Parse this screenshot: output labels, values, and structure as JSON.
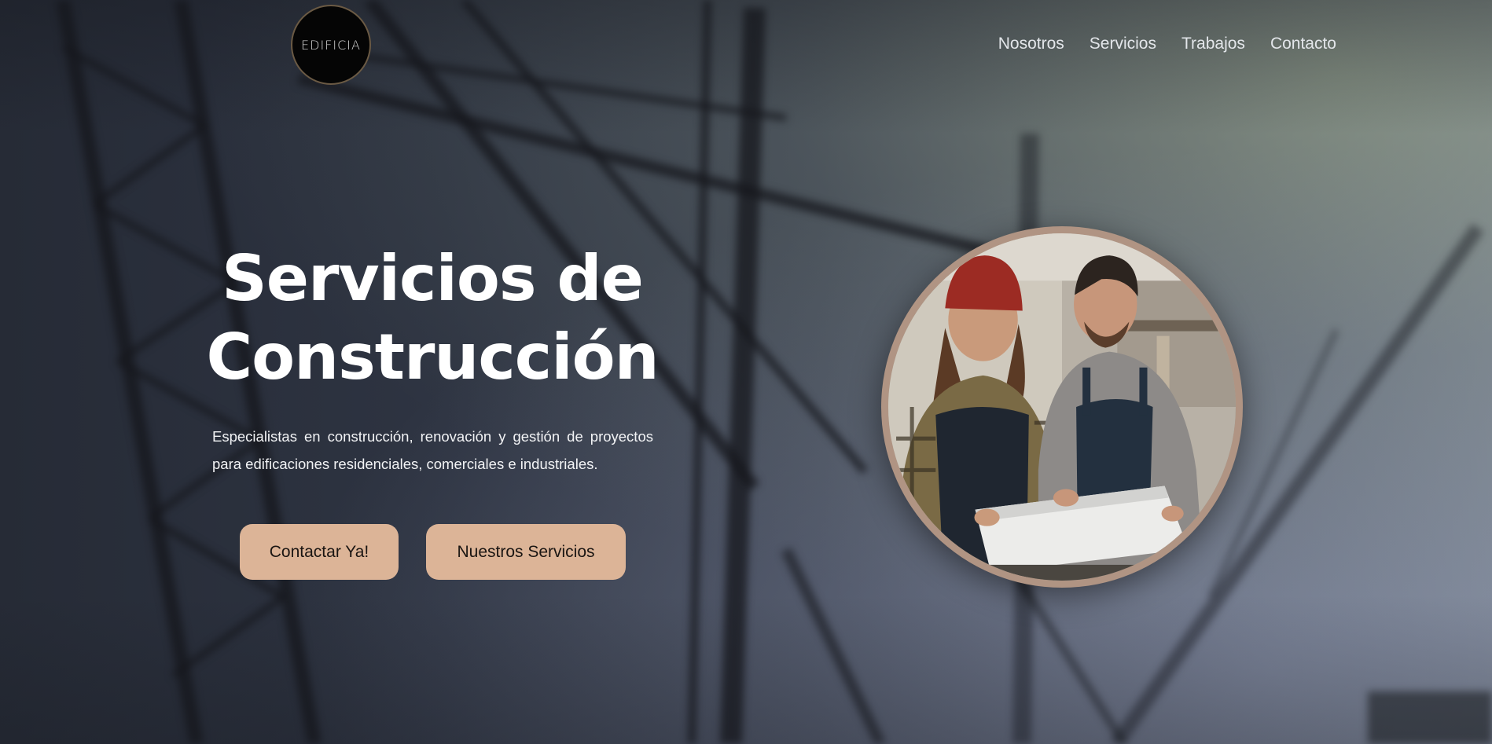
{
  "brand": {
    "logo_text": "EDIFICIA"
  },
  "nav": {
    "items": [
      {
        "label": "Nosotros"
      },
      {
        "label": "Servicios"
      },
      {
        "label": "Trabajos"
      },
      {
        "label": "Contacto"
      }
    ]
  },
  "hero": {
    "title_line1": "Servicios de",
    "title_line2": "Construcción",
    "description": "Especialistas en construcción, renovación y gestión de proyectos para edificaciones residenciales, comerciales e industriales.",
    "primary_button": "Contactar Ya!",
    "secondary_button": "Nuestros Servicios",
    "image_icon": "workers-photo"
  },
  "colors": {
    "accent": "#dcb497",
    "photo_ring": "#b09483",
    "logo_bg": "#050505"
  }
}
